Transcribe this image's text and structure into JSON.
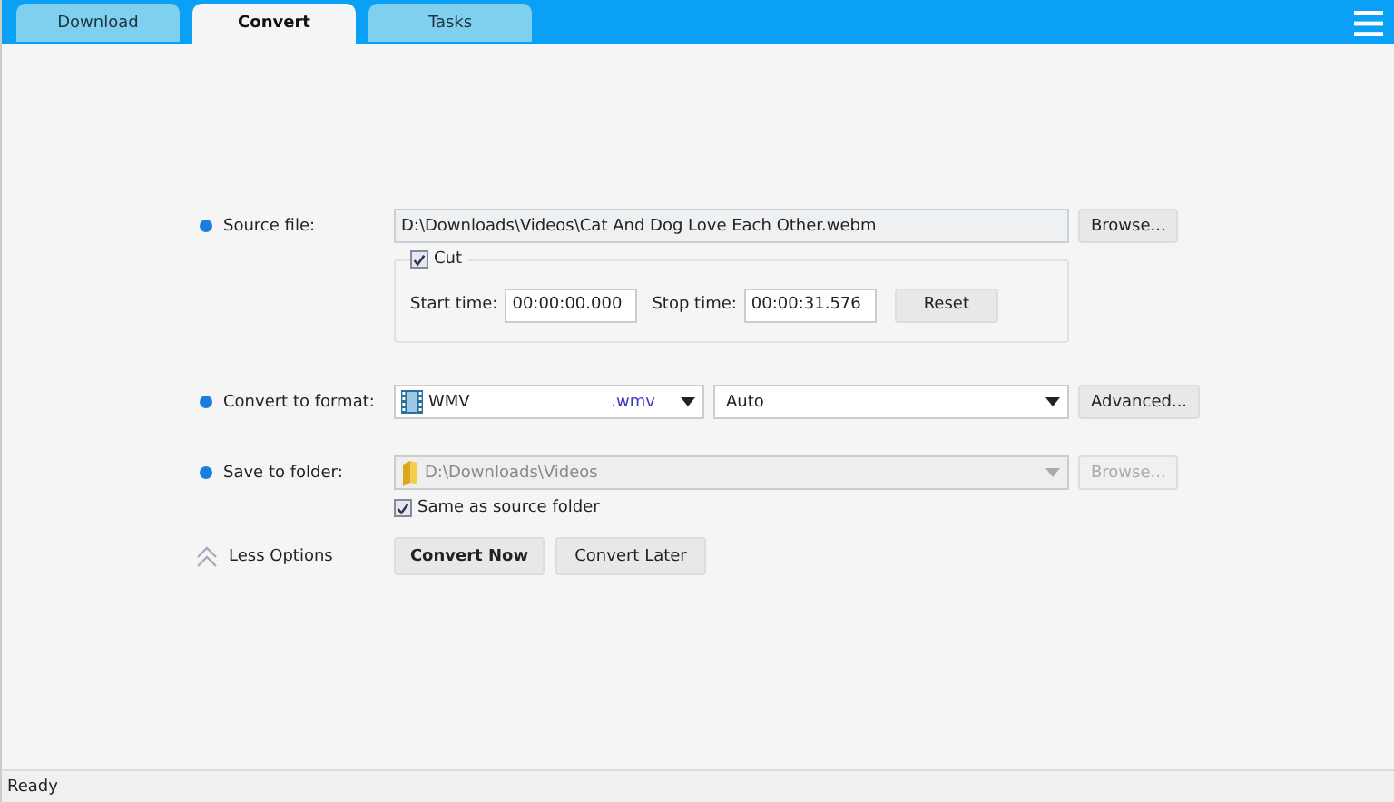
{
  "tabs": [
    {
      "label": "Download",
      "selected": false
    },
    {
      "label": "Convert",
      "selected": true
    },
    {
      "label": "Tasks",
      "selected": false
    }
  ],
  "source_file": {
    "label": "Source file:",
    "value": "D:\\Downloads\\Videos\\Cat And Dog Love Each Other.webm",
    "button": "Browse..."
  },
  "cut": {
    "label": "Cut",
    "checked": true,
    "start_label": "Start time:",
    "start_value": "00:00:00.000",
    "stop_label": "Stop time:",
    "stop_value": "00:00:31.576",
    "button": "Reset"
  },
  "convert_format": {
    "label": "Convert to format:",
    "format": "WMV",
    "extension": ".wmv",
    "quality": "Auto",
    "button": "Advanced..."
  },
  "save_folder": {
    "label": "Save to folder:",
    "value": "D:\\Downloads\\Videos",
    "disabled": true,
    "button": "Browse...",
    "same_as_source": {
      "label": "Same as source folder",
      "checked": true
    }
  },
  "less_options": "Less Options",
  "actions": [
    {
      "label": "Convert Now",
      "primary": true
    },
    {
      "label": "Convert Later",
      "primary": false
    }
  ],
  "status_bar": "Ready"
}
